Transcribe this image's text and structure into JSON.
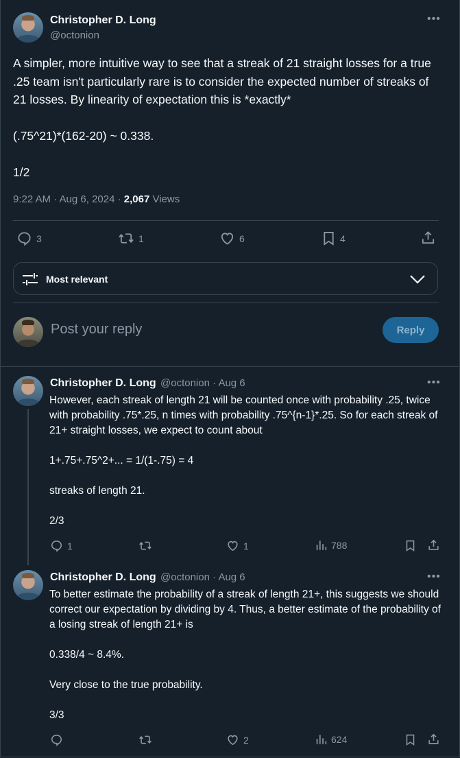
{
  "main_tweet": {
    "author_name": "Christopher D. Long",
    "author_handle": "@octonion",
    "text": "A simpler, more intuitive way to see that a streak of 21 straight losses for a true .25 team isn't particularly rare is to consider the expected number of streaks of 21 losses. By linearity of expectation this is *exactly*\n\n(.75^21)*(162-20) ~ 0.338.\n\n1/2",
    "time": "9:22 AM · Aug 6, 2024 · ",
    "views_count": "2,067",
    "views_label": " Views",
    "replies": "3",
    "retweets": "1",
    "likes": "6",
    "bookmarks": "4"
  },
  "sort": {
    "label": "Most relevant"
  },
  "composer": {
    "placeholder": "Post your reply",
    "button_label": "Reply"
  },
  "replies": [
    {
      "author_name": "Christopher D. Long",
      "meta": "@octonion · Aug 6",
      "text": "However, each streak of length 21 will be counted once with probability .25, twice with probability .75*.25, n times with probability .75^{n-1}*.25. So for each streak of 21+ straight losses, we expect to count about\n\n1+.75+.75^2+... = 1/(1-.75) = 4\n\nstreaks of length 21.\n\n2/3",
      "replies": "1",
      "retweets": "",
      "likes": "1",
      "views": "788"
    },
    {
      "author_name": "Christopher D. Long",
      "meta": "@octonion · Aug 6",
      "text": "To better estimate the probability of a streak of length 21+, this suggests we should correct our expectation by dividing by 4. Thus, a better estimate of the probability of a losing streak of length 21+ is\n\n0.338/4 ~ 8.4%.\n\nVery close to the true probability.\n\n3/3",
      "replies": "",
      "retweets": "",
      "likes": "2",
      "views": "624"
    }
  ],
  "colors": {
    "background": "#15202b",
    "text": "#f7f9f9",
    "muted": "#8b98a5",
    "border": "#38444d",
    "reply_button": "#1d6596"
  }
}
